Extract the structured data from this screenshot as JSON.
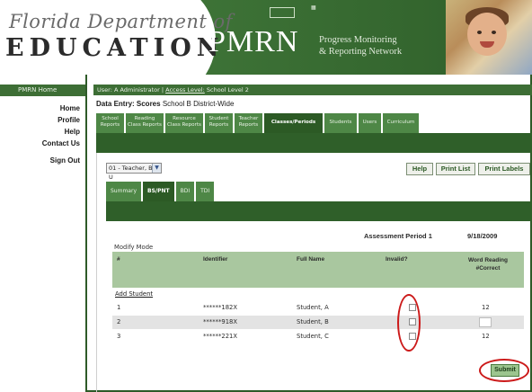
{
  "header": {
    "logo_top": "Florida Department of",
    "logo_bottom": "EDUCATION",
    "app_name": "PMRN",
    "tagline_line1": "Progress Monitoring",
    "tagline_line2": "& Reporting Network"
  },
  "sidebar": {
    "home_tab": "PMRN Home",
    "items": [
      {
        "label": "Home"
      },
      {
        "label": "Profile"
      },
      {
        "label": "Help"
      },
      {
        "label": "Contact Us"
      },
      {
        "label": "Sign Out"
      }
    ]
  },
  "userbar": {
    "user": "User: A Administrator |",
    "access_link": "Access Level:",
    "access_value": "School Level 2"
  },
  "page": {
    "title_bold": "Data Entry: Scores",
    "title_rest": "School B District-Wide"
  },
  "tabs": [
    {
      "label": "School Reports",
      "active": false
    },
    {
      "label": "Reading Class Reports",
      "active": false
    },
    {
      "label": "Resource Class Reports",
      "active": false
    },
    {
      "label": "Student Reports",
      "active": false
    },
    {
      "label": "Teacher Reports",
      "active": false
    },
    {
      "label": "Classes/Periods",
      "active": true
    },
    {
      "label": "Students",
      "active": false
    },
    {
      "label": "Users",
      "active": false
    },
    {
      "label": "Curriculum",
      "active": false
    }
  ],
  "class_select": {
    "value": "01 - Teacher, B - U"
  },
  "buttons": {
    "help": "Help",
    "print_list": "Print List",
    "print_labels": "Print Labels",
    "submit": "Submit"
  },
  "subtabs": [
    {
      "label": "Summary",
      "active": false
    },
    {
      "label": "BS/PNT",
      "active": true
    },
    {
      "label": "BDI",
      "active": false
    },
    {
      "label": "TDI",
      "active": false
    }
  ],
  "assessment": {
    "period_label": "Assessment Period 1",
    "date": "9/18/2009"
  },
  "table": {
    "mode": "Modify Mode",
    "headers": {
      "num": "#",
      "identifier": "Identifier",
      "full_name": "Full Name",
      "invalid": "Invalid?",
      "word_reading": "Word Reading #Correct"
    },
    "add_student": "Add Student",
    "rows": [
      {
        "num": "1",
        "identifier": "******182X",
        "full_name": "Student, A",
        "invalid": false,
        "word_reading": "12"
      },
      {
        "num": "2",
        "identifier": "******918X",
        "full_name": "Student, B",
        "invalid": false,
        "word_reading": ""
      },
      {
        "num": "3",
        "identifier": "******221X",
        "full_name": "Student, C",
        "invalid": false,
        "word_reading": "12"
      }
    ]
  },
  "colors": {
    "brand_green": "#3d6e35",
    "dark_green": "#2f5f29",
    "header_row": "#a9c79f",
    "highlight_red": "#cc1a1a"
  }
}
